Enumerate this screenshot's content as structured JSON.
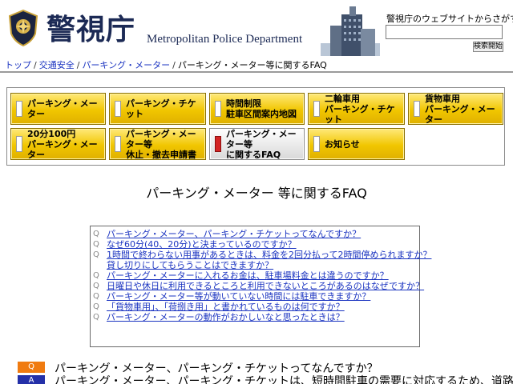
{
  "header": {
    "site_kanji": "警視庁",
    "site_en": "Metropolitan Police Department",
    "search_caption": "警視庁のウェブサイトからさがす",
    "search_value": "",
    "search_button": "検索開始",
    "brand_color": "#1c2a55"
  },
  "breadcrumb": {
    "items": [
      "トップ",
      "交通安全",
      "パーキング・メーター"
    ],
    "current": "パーキング・メーター等に関するFAQ",
    "separator": "/"
  },
  "nav": {
    "items": [
      {
        "label": "パーキング・メーター",
        "active": false
      },
      {
        "label": "パーキング・チケット",
        "active": false
      },
      {
        "label": "時間制限\n駐車区間案内地図",
        "active": false
      },
      {
        "label": "二輪車用\nパーキング・チケット",
        "active": false
      },
      {
        "label": "貨物車用\nパーキング・メーター",
        "active": false
      },
      {
        "label": "20分100円\nパーキング・メーター",
        "active": false
      },
      {
        "label": "パーキング・メーター等\n休止・撤去申請書",
        "active": false
      },
      {
        "label": "パーキング・メーター等\nに関するFAQ",
        "active": true
      },
      {
        "label": "お知らせ",
        "active": false
      }
    ],
    "button_color": "#f1c600",
    "active_marker_color": "#d42424"
  },
  "page_title": "パーキング・メーター 等に関するFAQ",
  "faq": {
    "marker": "Q",
    "items": [
      {
        "line1": "パーキング・メーター、パーキング・チケットってなんですか？"
      },
      {
        "line1": "なぜ60分(40、20分)と決まっているのですか？"
      },
      {
        "line1": "1時間で終わらない用事があるときは、料金を2回分払って2時間停められますか？",
        "line2": "貸し切りにしてもらうことはできますか？"
      },
      {
        "line1": "パーキング・メーターに入れるお金は、駐車場料金とは違うのですか？"
      },
      {
        "line1": "日曜日や休日に利用できるところと利用できないところがあるのはなぜですか？"
      },
      {
        "line1": "パーキング・メーター等が動いていない時間には駐車できますか？"
      },
      {
        "line1": "「貨物車用」、「荷捌き用」と書かれているものは何ですか？"
      },
      {
        "line1": "パーキング・メーターの動作がおかしいなと思ったときは？"
      }
    ]
  },
  "answer": {
    "q_badge": "Q",
    "a_badge": "A",
    "q_color": "#f07b10",
    "a_color": "#2430a8",
    "question": "パーキング・メーター、パーキング・チケットってなんですか？",
    "answer_start": "パーキング・メーター、パーキング・チケットは、短時間駐車の需要に対応するため、道路状"
  }
}
